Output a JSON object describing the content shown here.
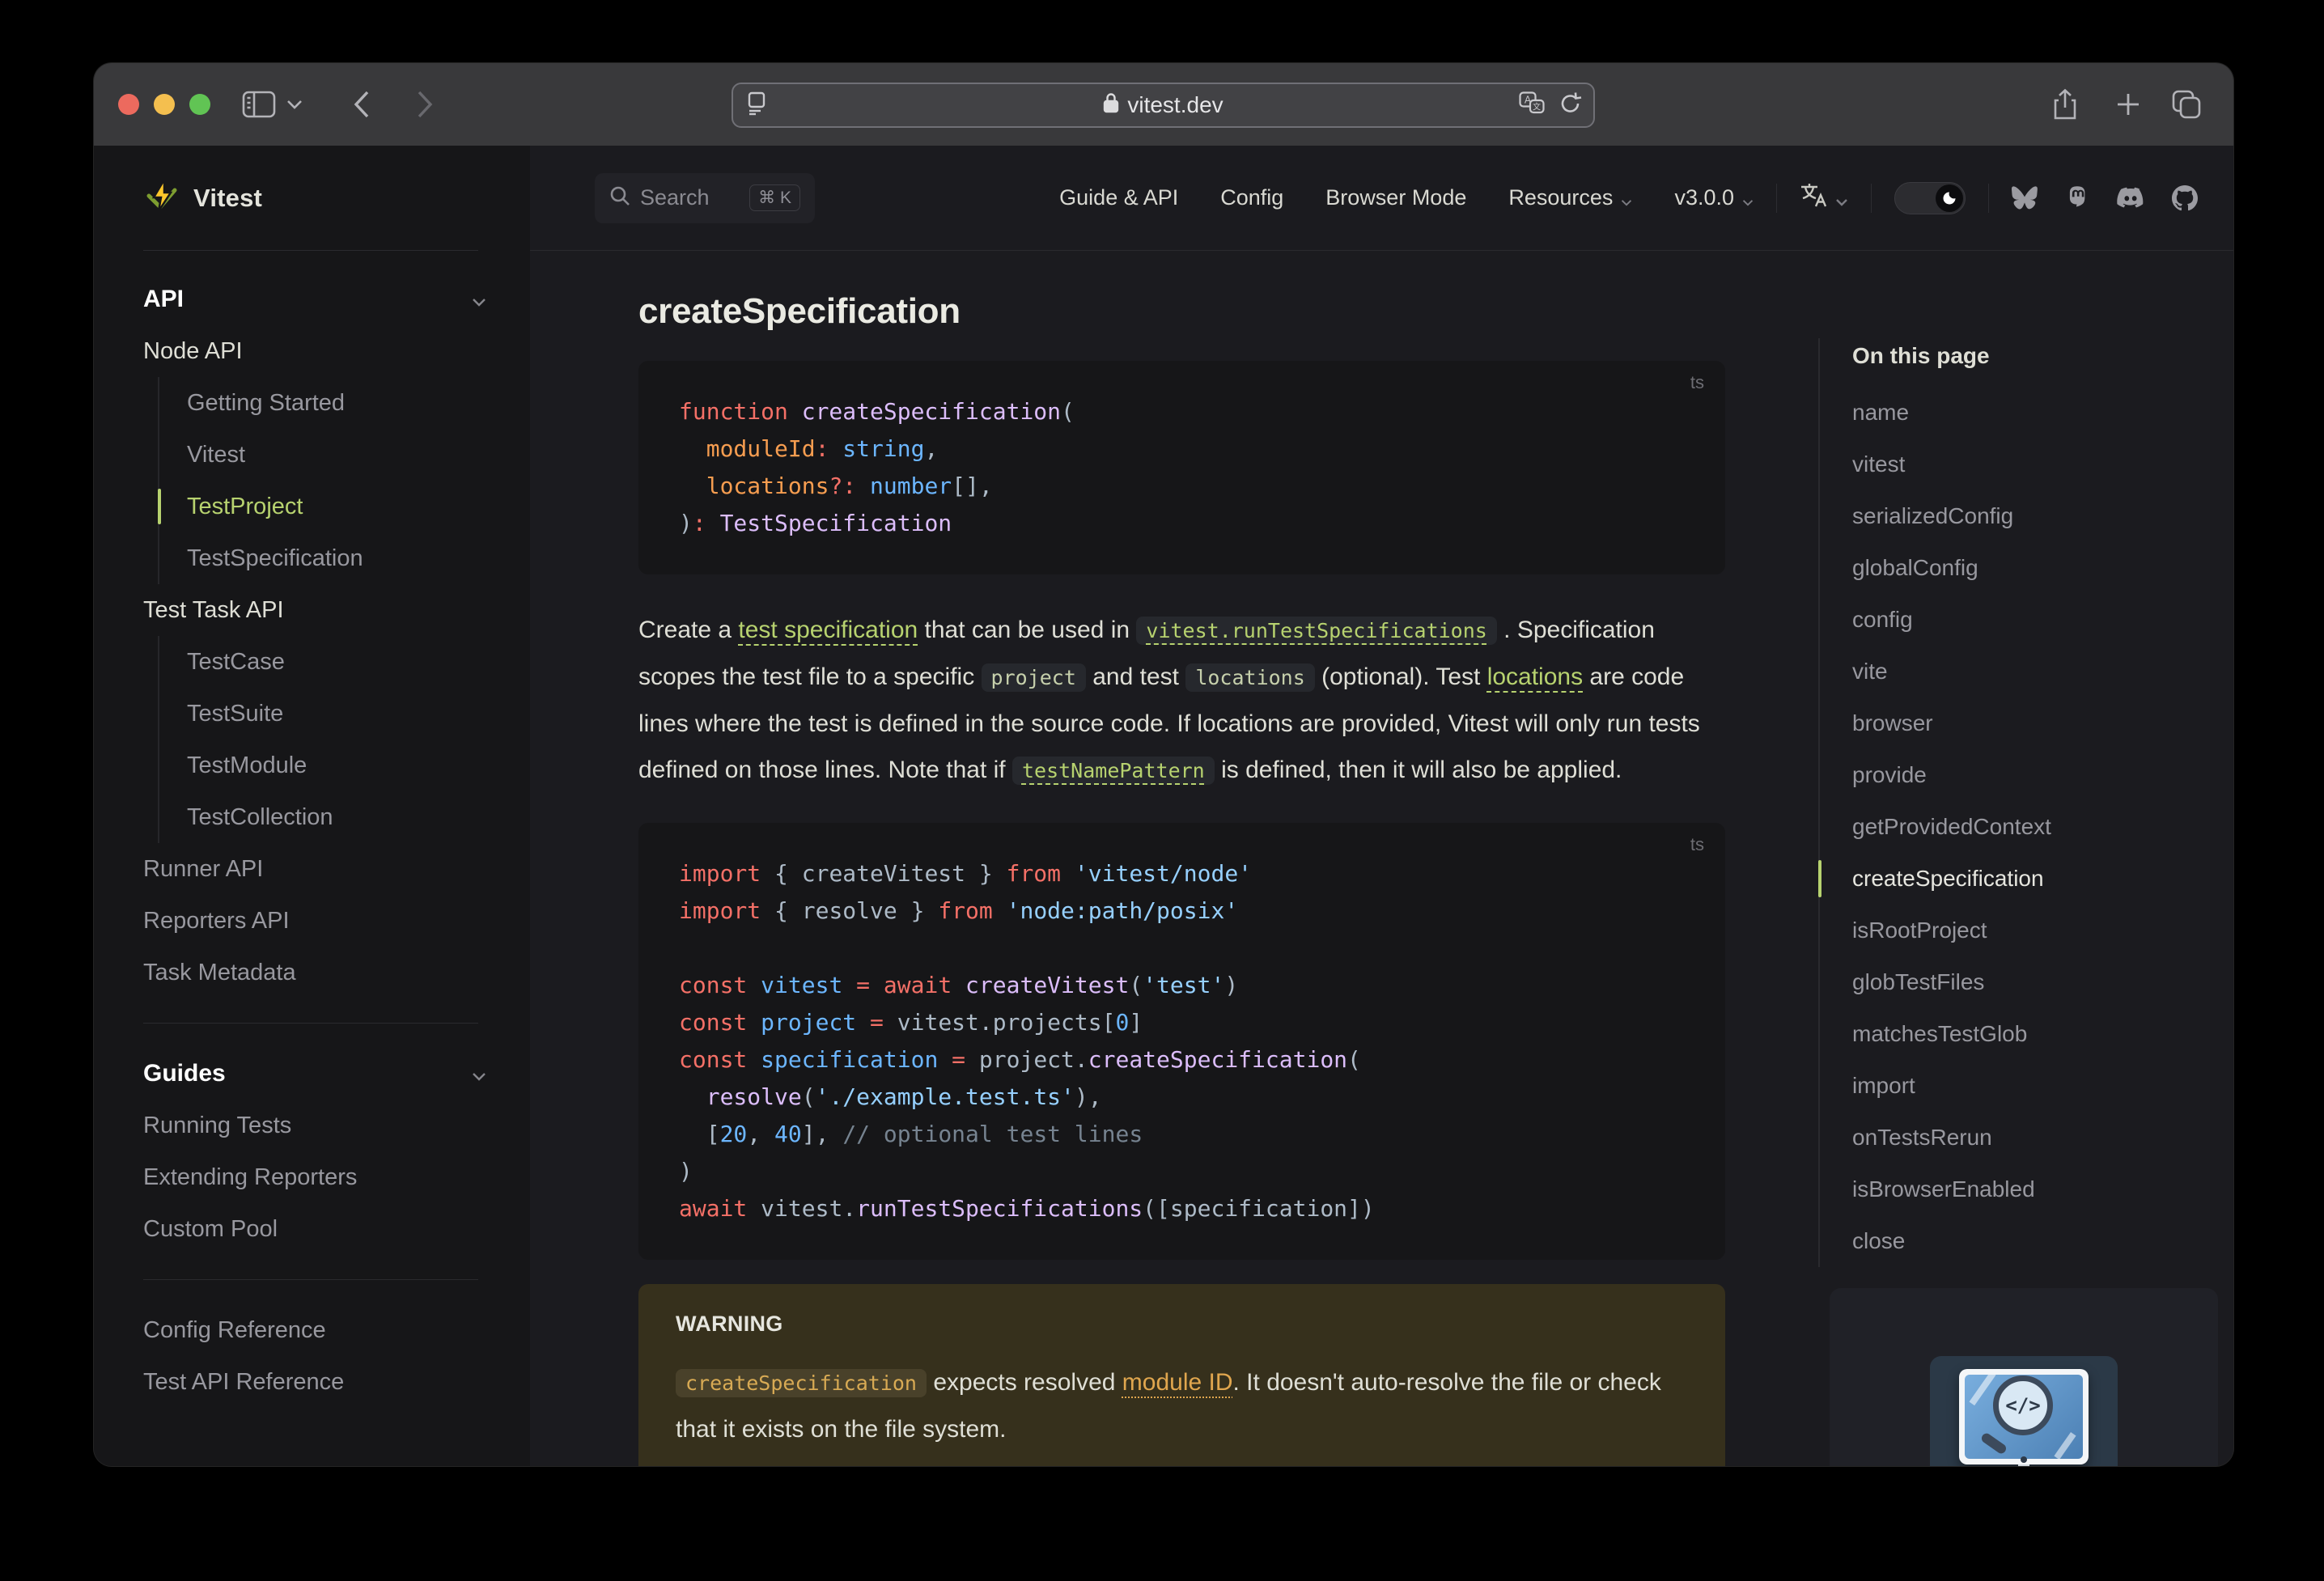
{
  "browser": {
    "url": "vitest.dev",
    "toolbar_icons": [
      "sidebar-toggle-icon",
      "chevron-down-icon",
      "back-icon",
      "forward-icon",
      "reader-icon",
      "lock-icon",
      "translate-icon",
      "reload-icon",
      "share-icon",
      "new-tab-icon",
      "tabs-overview-icon"
    ]
  },
  "header": {
    "logo_text": "Vitest",
    "logo_icon": "vitest-bolt-logo",
    "search": {
      "label": "Search",
      "shortcut": "⌘ K"
    },
    "nav": [
      {
        "label": "Guide & API",
        "chevron": false
      },
      {
        "label": "Config",
        "chevron": false
      },
      {
        "label": "Browser Mode",
        "chevron": false
      },
      {
        "label": "Resources",
        "chevron": true
      },
      {
        "label": "v3.0.0",
        "chevron": true
      }
    ],
    "language_icon": "translate-language-icon",
    "theme_toggle_icon": "moon-icon",
    "socials": [
      "bluesky",
      "mastodon",
      "discord",
      "github"
    ]
  },
  "sidebar": {
    "sections": [
      {
        "type": "header",
        "label": "API",
        "chevron": true
      },
      {
        "type": "heading",
        "label": "Node API"
      },
      {
        "type": "subitems",
        "items": [
          {
            "label": "Getting Started",
            "active": false
          },
          {
            "label": "Vitest",
            "active": false
          },
          {
            "label": "TestProject",
            "active": true
          },
          {
            "label": "TestSpecification",
            "active": false
          }
        ]
      },
      {
        "type": "heading",
        "label": "Test Task API"
      },
      {
        "type": "subitems",
        "items": [
          {
            "label": "TestCase",
            "active": false
          },
          {
            "label": "TestSuite",
            "active": false
          },
          {
            "label": "TestModule",
            "active": false
          },
          {
            "label": "TestCollection",
            "active": false
          }
        ]
      },
      {
        "type": "item",
        "label": "Runner API"
      },
      {
        "type": "item",
        "label": "Reporters API"
      },
      {
        "type": "item",
        "label": "Task Metadata"
      },
      {
        "type": "divider"
      },
      {
        "type": "header",
        "label": "Guides",
        "chevron": true
      },
      {
        "type": "item",
        "label": "Running Tests"
      },
      {
        "type": "item",
        "label": "Extending Reporters"
      },
      {
        "type": "item",
        "label": "Custom Pool"
      },
      {
        "type": "divider"
      },
      {
        "type": "item",
        "label": "Config Reference"
      },
      {
        "type": "item",
        "label": "Test API Reference"
      }
    ]
  },
  "main": {
    "title": "createSpecification",
    "code_blocks": [
      {
        "lang": "ts",
        "lines": [
          [
            [
              "k",
              "function"
            ],
            [
              "w",
              " "
            ],
            [
              "f",
              "createSpecification"
            ],
            [
              "w",
              "("
            ]
          ],
          [
            [
              "w",
              "  "
            ],
            [
              "p",
              "moduleId"
            ],
            [
              "k",
              ":"
            ],
            [
              "w",
              " "
            ],
            [
              "v",
              "string"
            ],
            [
              "w",
              ","
            ]
          ],
          [
            [
              "w",
              "  "
            ],
            [
              "p",
              "locations"
            ],
            [
              "k",
              "?:"
            ],
            [
              "w",
              " "
            ],
            [
              "v",
              "number"
            ],
            [
              "w",
              "[],"
            ]
          ],
          [
            [
              "w",
              ")"
            ],
            [
              "k",
              ":"
            ],
            [
              "w",
              " "
            ],
            [
              "f",
              "TestSpecification"
            ]
          ]
        ]
      },
      {
        "lang": "ts",
        "lines": [
          [
            [
              "k",
              "import"
            ],
            [
              "w",
              " { createVitest } "
            ],
            [
              "k",
              "from"
            ],
            [
              "w",
              " "
            ],
            [
              "s",
              "'vitest/node'"
            ]
          ],
          [
            [
              "k",
              "import"
            ],
            [
              "w",
              " { resolve } "
            ],
            [
              "k",
              "from"
            ],
            [
              "w",
              " "
            ],
            [
              "s",
              "'node:path/posix'"
            ]
          ],
          [],
          [
            [
              "k",
              "const"
            ],
            [
              "w",
              " "
            ],
            [
              "v",
              "vitest"
            ],
            [
              "w",
              " "
            ],
            [
              "k",
              "="
            ],
            [
              "w",
              " "
            ],
            [
              "k",
              "await"
            ],
            [
              "w",
              " "
            ],
            [
              "f",
              "createVitest"
            ],
            [
              "w",
              "("
            ],
            [
              "s",
              "'test'"
            ],
            [
              "w",
              ")"
            ]
          ],
          [
            [
              "k",
              "const"
            ],
            [
              "w",
              " "
            ],
            [
              "v",
              "project"
            ],
            [
              "w",
              " "
            ],
            [
              "k",
              "="
            ],
            [
              "w",
              " vitest.projects["
            ],
            [
              "n",
              "0"
            ],
            [
              "w",
              "]"
            ]
          ],
          [
            [
              "k",
              "const"
            ],
            [
              "w",
              " "
            ],
            [
              "v",
              "specification"
            ],
            [
              "w",
              " "
            ],
            [
              "k",
              "="
            ],
            [
              "w",
              " project."
            ],
            [
              "f",
              "createSpecification"
            ],
            [
              "w",
              "("
            ]
          ],
          [
            [
              "w",
              "  "
            ],
            [
              "f",
              "resolve"
            ],
            [
              "w",
              "("
            ],
            [
              "s",
              "'./example.test.ts'"
            ],
            [
              "w",
              "),"
            ]
          ],
          [
            [
              "w",
              "  ["
            ],
            [
              "n",
              "20"
            ],
            [
              "w",
              ", "
            ],
            [
              "n",
              "40"
            ],
            [
              "w",
              "], "
            ],
            [
              "c",
              "// optional test lines"
            ]
          ],
          [
            [
              "w",
              ")"
            ]
          ],
          [
            [
              "k",
              "await"
            ],
            [
              "w",
              " vitest."
            ],
            [
              "f",
              "runTestSpecifications"
            ],
            [
              "w",
              "([specification])"
            ]
          ]
        ]
      }
    ],
    "paragraph": {
      "runs": [
        [
          "text",
          "Create a "
        ],
        [
          "link",
          "test specification"
        ],
        [
          "text",
          " that can be used in "
        ],
        [
          "codelink",
          "vitest.runTestSpecifications"
        ],
        [
          "text",
          " . Specification scopes the test file to a specific "
        ],
        [
          "code",
          "project"
        ],
        [
          "text",
          " and test "
        ],
        [
          "code",
          "locations"
        ],
        [
          "text",
          " (optional). Test "
        ],
        [
          "link",
          "locations"
        ],
        [
          "text",
          " are code lines where the test is defined in the source code. If locations are provided, Vitest will only run tests defined on those lines. Note that if "
        ],
        [
          "codelink",
          "testNamePattern"
        ],
        [
          "text",
          " is defined, then it will also be applied."
        ]
      ]
    },
    "warning": {
      "title": "WARNING",
      "runs": [
        [
          "code",
          "createSpecification"
        ],
        [
          "text",
          " expects resolved "
        ],
        [
          "link",
          "module ID"
        ],
        [
          "text",
          ". It doesn't auto-resolve the file or check that it exists on the file system."
        ]
      ]
    }
  },
  "outline": {
    "title": "On this page",
    "active": "createSpecification",
    "items": [
      "name",
      "vitest",
      "serializedConfig",
      "globalConfig",
      "config",
      "vite",
      "browser",
      "provide",
      "getProvidedContext",
      "createSpecification",
      "isRootProject",
      "globTestFiles",
      "matchesTestGlob",
      "import",
      "onTestsRerun",
      "isBrowserEnabled",
      "close"
    ]
  },
  "ad_card": {
    "illustration": "code-search-monitor-illustration",
    "glyph": "</>"
  },
  "colors": {
    "brand": "#b7d26f",
    "warning_bg": "#36301c",
    "code_bg": "#161618",
    "page_bg": "#1b1b1f"
  }
}
